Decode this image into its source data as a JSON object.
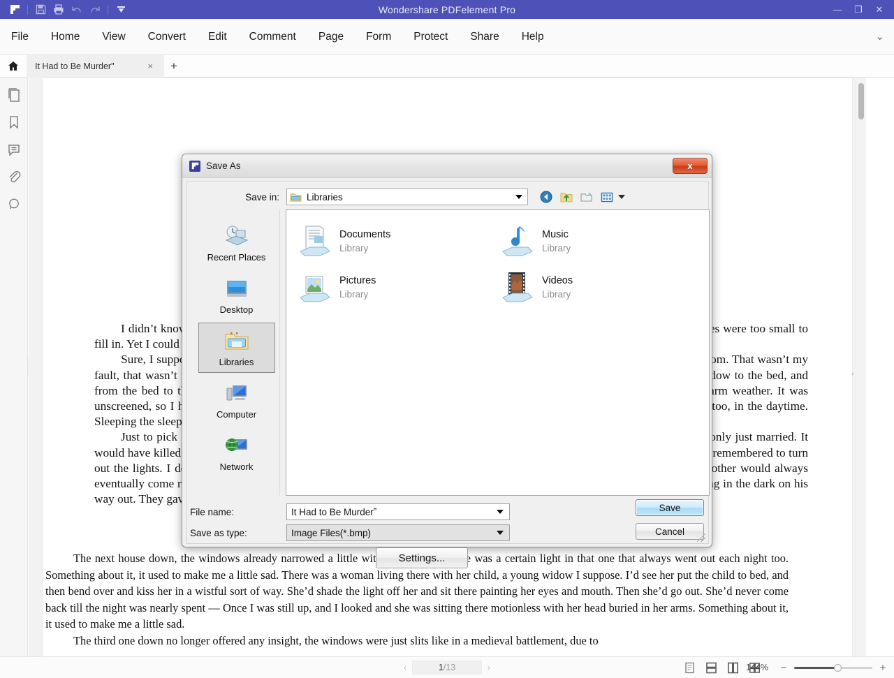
{
  "window": {
    "title": "Wondershare PDFelement Pro",
    "quick_access": [
      {
        "name": "app-logo",
        "glyph": "◤"
      },
      {
        "name": "save-icon",
        "glyph": "▤"
      },
      {
        "name": "print-icon",
        "glyph": "⎙"
      },
      {
        "name": "undo-icon",
        "glyph": "↺"
      },
      {
        "name": "redo-icon",
        "glyph": "↻"
      },
      {
        "name": "customize-icon",
        "glyph": "▼"
      }
    ],
    "controls": {
      "minimize": "—",
      "maximize": "❐",
      "close": "✕"
    }
  },
  "menubar": {
    "items": [
      "File",
      "Home",
      "View",
      "Convert",
      "Edit",
      "Comment",
      "Page",
      "Form",
      "Protect",
      "Share",
      "Help"
    ],
    "collapse_glyph": "⌄"
  },
  "tabbar": {
    "home_glyph": "⌂",
    "document_tab": "It Had to Be Murder\"",
    "close_glyph": "×",
    "add_glyph": "+"
  },
  "left_rail": {
    "items": [
      {
        "name": "pages-panel-icon",
        "label": "Pages"
      },
      {
        "name": "bookmarks-panel-icon",
        "label": "Bookmarks"
      },
      {
        "name": "comments-panel-icon",
        "label": "Comments"
      },
      {
        "name": "attachments-panel-icon",
        "label": "Attachments"
      },
      {
        "name": "search-panel-icon",
        "label": "Search"
      }
    ],
    "handle_glyph": "›"
  },
  "document": {
    "title": "“It Had to Be Murder”",
    "paragraph_1": "I didn’t know their names. I’d never heard their voices. I didn’t even know them by sight, strictly speaking, for their faces were too small to fill in. Yet I could have constructed a timetable of their comings and goings, their daily habits and activities.",
    "paragraph_2": "Sure, I suppose it was a little bit like prying, could even have been mistaken for the fevered concentration of a Peeping Tom. That wasn’t my fault, that wasn’t the idea. The idea was, my movements were strictly limited just around this time. I could get from the window to the bed, and from the bed to the window, and that was all. The bay window was about the best feature my rear bedroom had in the warm weather. It was unscreened, so I had to sit with the light out or I would have had every insect in the vicinity in on me. It was hot as blazes, too, in the daytime. Sleeping the sleep of the just, sure, but a couple of reading books to ward off boredom.",
    "paragraph_3": "Just to pick a few at random: Straight over, and the windows square, there was a young jitterbug couple in their teens, only just married. It would have killed them to stay home one night. They were always in such a hurry to go, wherever it was they went, they never remembered to turn out the lights. I don’t think it missed a night. But they never forgot altogether, either. I was to watch them at it. One or the other would always eventually come rushing back in about five minutes, probably from all the way down in the street, and turn them off. Something in the dark on his way out. They gave me an inward chuckle, those two.",
    "paragraph_4": "The next house down, the windows already narrowed a little with perspective. There was a certain light in that one that always went out each night too. Something about it, it used to make me a little sad. There was a woman living there with her child, a young widow I suppose. I’d see her put the child to bed, and then bend over and kiss her in a wistful sort of way. She’d shade the light off her and sit there painting her eyes and mouth. Then she’d go out. She’d never come back till the night was nearly spent — Once I was still up, and I looked and she was sitting there motionless with her head buried in her arms. Something about it, it used to make me a little sad.",
    "paragraph_5": "The third one down no longer offered any insight, the windows were just slits like in a medieval battlement, due to"
  },
  "statusbar": {
    "prev_glyph": "‹",
    "next_glyph": "›",
    "current_page": "1",
    "total_pages": "/13",
    "view_modes": [
      {
        "name": "single-page-view-icon"
      },
      {
        "name": "continuous-view-icon"
      },
      {
        "name": "facing-page-view-icon"
      },
      {
        "name": "thumbnail-grid-view-icon"
      }
    ],
    "zoom_level": "144%",
    "zoom_out_glyph": "−",
    "zoom_in_glyph": "+"
  },
  "dialog": {
    "title": "Save As",
    "close_label": "x",
    "save_in_label": "Save in:",
    "save_in_value": "Libraries",
    "toolbar_icons": [
      {
        "name": "back-navigate-icon"
      },
      {
        "name": "up-one-level-icon"
      },
      {
        "name": "create-new-folder-icon"
      },
      {
        "name": "views-icon"
      }
    ],
    "places": [
      {
        "name": "recent-places",
        "label": "Recent Places",
        "selected": false
      },
      {
        "name": "desktop",
        "label": "Desktop",
        "selected": false
      },
      {
        "name": "libraries",
        "label": "Libraries",
        "selected": true
      },
      {
        "name": "computer",
        "label": "Computer",
        "selected": false
      },
      {
        "name": "network",
        "label": "Network",
        "selected": false
      }
    ],
    "files": [
      {
        "name": "Documents",
        "sub": "Library",
        "icon": "documents-library-icon"
      },
      {
        "name": "Music",
        "sub": "Library",
        "icon": "music-library-icon"
      },
      {
        "name": "Pictures",
        "sub": "Library",
        "icon": "pictures-library-icon"
      },
      {
        "name": "Videos",
        "sub": "Library",
        "icon": "videos-library-icon"
      }
    ],
    "file_name_label": "File name:",
    "file_name_value": "It Had to Be Murderˮ",
    "save_as_type_label": "Save as type:",
    "save_as_type_value": "Image Files(*.bmp)",
    "save_button": "Save",
    "cancel_button": "Cancel",
    "settings_button": "Settings..."
  },
  "colors": {
    "titlebar": "#4e51b8",
    "dialog_bg": "#f0f0f0",
    "accent_primary": "#a9dbf7",
    "close_red": "#c63c16"
  }
}
